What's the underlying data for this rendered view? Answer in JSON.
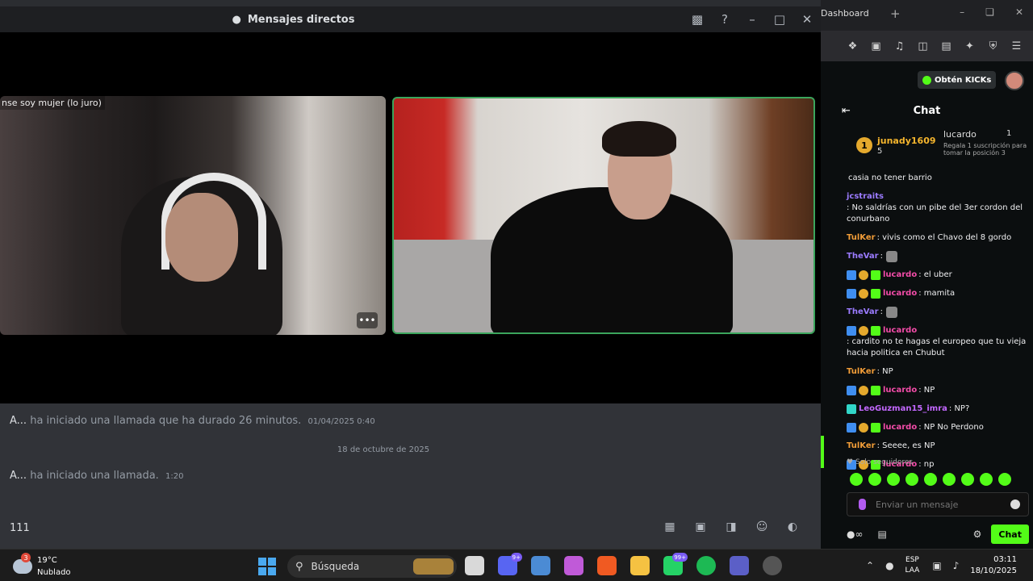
{
  "discord": {
    "window_title": "Mensajes directos",
    "left_tile_label": "nse soy mujer (lo juro)",
    "more_button": "•••",
    "messages": [
      {
        "user": "A...",
        "text": "ha iniciado una llamada que ha durado 26 minutos.",
        "time": "01/04/2025 0:40"
      },
      {
        "user": "A...",
        "text": "ha iniciado una llamada.",
        "time": "1:20"
      }
    ],
    "date_divider": "18 de octubre de 2025",
    "composer_value": "111"
  },
  "browser": {
    "tab_label": "Dashboard",
    "new_tab": "+",
    "kicks_button": "Obtén KICKs"
  },
  "chat": {
    "title": "Chat",
    "pinned": {
      "rank": "1",
      "top_user": "junady1609",
      "top_count": "5",
      "gifter": "lucardo",
      "gifter_count": "1",
      "description": "Regala 1 suscripción para tomar la posición 3"
    },
    "messages": [
      {
        "user": "",
        "text": "casia no tener barrio",
        "color": "white",
        "badges": []
      },
      {
        "user": "jcstraits",
        "text": ": No saldrías con un pibe del 3er cordon del conurbano",
        "color": "purple",
        "badges": []
      },
      {
        "user": "TulKer",
        "text": ": vivis como el Chavo del 8 gordo",
        "color": "orange",
        "badges": []
      },
      {
        "user": "TheVar",
        "text": ":",
        "color": "purple",
        "badges": [],
        "emote": true
      },
      {
        "user": "lucardo",
        "text": ": el uber",
        "color": "pink",
        "badges": [
          "blue",
          "gold",
          "green"
        ]
      },
      {
        "user": "lucardo",
        "text": ": mamita",
        "color": "pink",
        "badges": [
          "blue",
          "gold",
          "green"
        ]
      },
      {
        "user": "TheVar",
        "text": ":",
        "color": "purple",
        "badges": [],
        "emote": true
      },
      {
        "user": "lucardo",
        "text": ": cardito no te hagas el europeo que tu vieja hacia politica en Chubut",
        "color": "pink",
        "badges": [
          "blue",
          "gold",
          "green"
        ]
      },
      {
        "user": "TulKer",
        "text": ": NP",
        "color": "orange",
        "badges": []
      },
      {
        "user": "lucardo",
        "text": ": NP",
        "color": "pink",
        "badges": [
          "blue",
          "gold",
          "green"
        ]
      },
      {
        "user": "LeoGuzman15_imra",
        "text": ": NP?",
        "color": "mag",
        "badges": [
          "cyan"
        ]
      },
      {
        "user": "lucardo",
        "text": ": NP No Perdono",
        "color": "pink",
        "badges": [
          "blue",
          "gold",
          "green"
        ]
      },
      {
        "user": "TulKer",
        "text": ": Seeee, es NP",
        "color": "orange",
        "badges": []
      },
      {
        "user": "lucardo",
        "text": ": np",
        "color": "pink",
        "badges": [
          "blue",
          "gold",
          "green"
        ]
      }
    ],
    "followers_only": "Solo seguidores",
    "input_placeholder": "Enviar un mensaje",
    "send_label": "Chat"
  },
  "taskbar": {
    "weather_temp": "19°C",
    "weather_desc": "Nublado",
    "weather_badge": "3",
    "search_label": "Búsqueda",
    "discord_badge": "9+",
    "whatsapp_badge": "99+",
    "lang_1": "ESP",
    "lang_2": "LAA",
    "time": "03:11",
    "date": "18/10/2025"
  },
  "colors": {
    "kick_green": "#53fc18",
    "discord_bg": "#313338",
    "speaking_border": "#3ba55c"
  }
}
